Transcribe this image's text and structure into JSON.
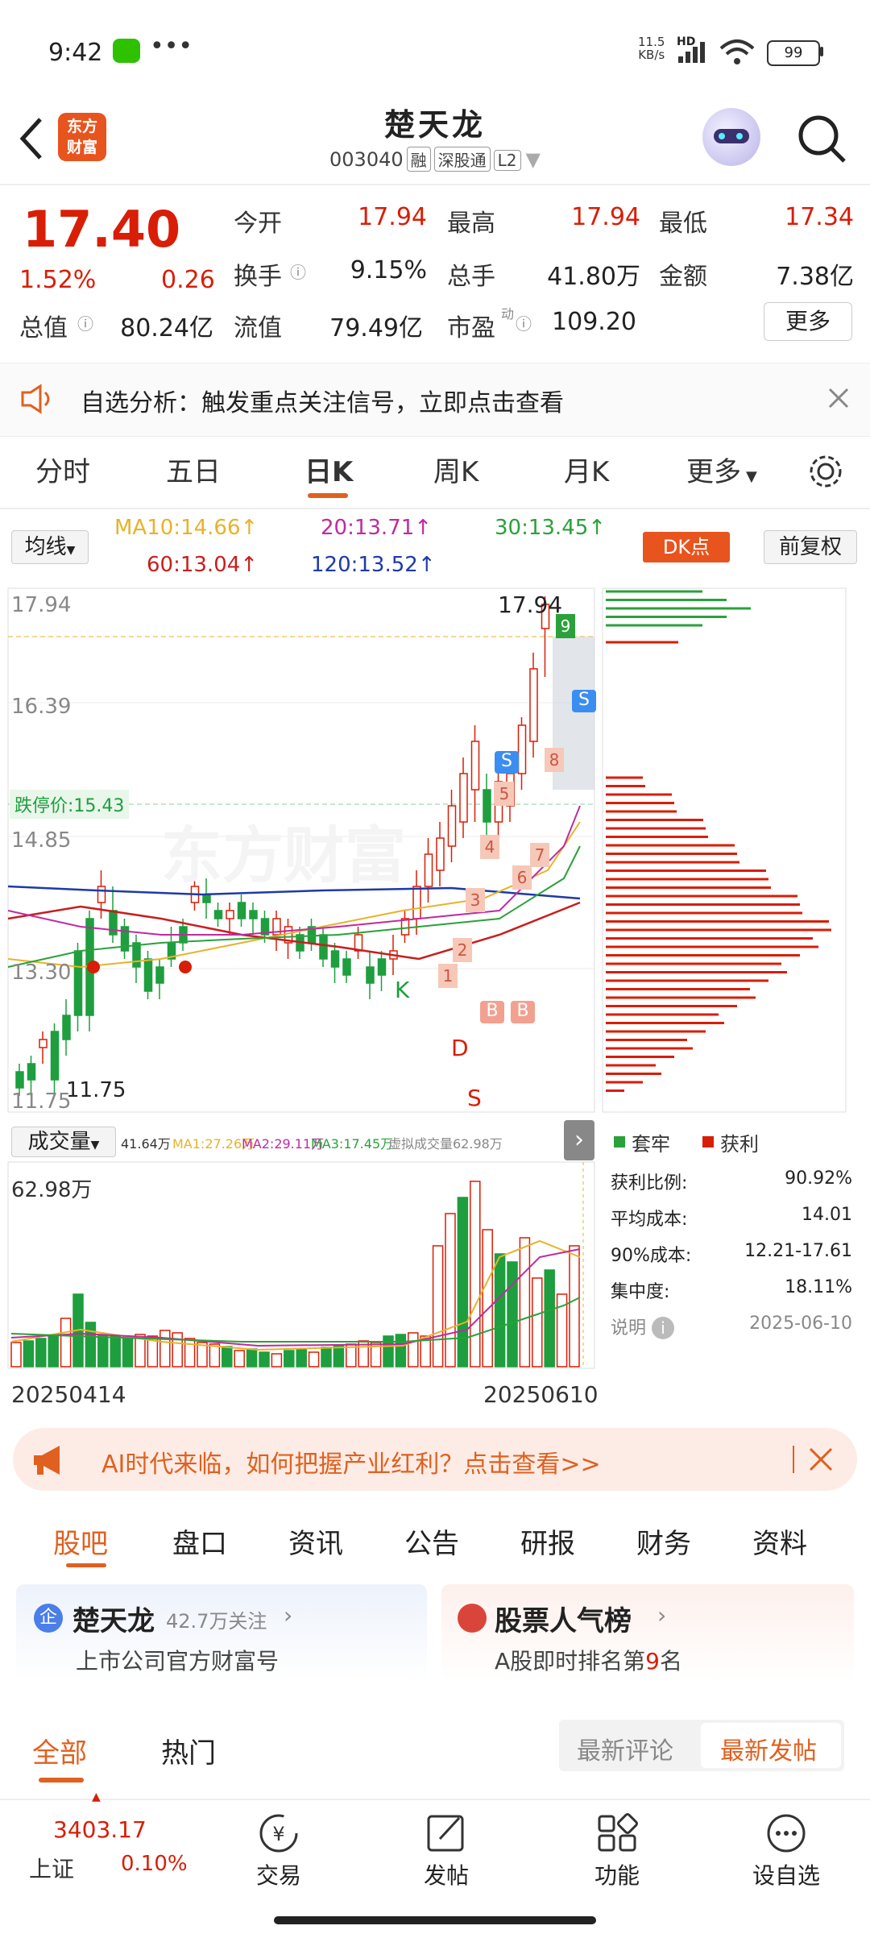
{
  "status_bar": {
    "time": "9:42",
    "net_speed_top": "11.5",
    "net_speed_bottom": "KB/s",
    "hd": "HD",
    "battery": "99"
  },
  "header": {
    "logo_line1": "东方",
    "logo_line2": "财富",
    "stock_name": "楚天龙",
    "stock_code": "003040",
    "tags": [
      "融",
      "深股通",
      "L2"
    ]
  },
  "quote": {
    "price": "17.40",
    "change_pct": "1.52%",
    "change": "0.26",
    "rows": [
      [
        {
          "label": "今开",
          "value": "17.94",
          "color": "red"
        },
        {
          "label": "最高",
          "value": "17.94",
          "color": "red"
        },
        {
          "label": "最低",
          "value": "17.34",
          "color": "red"
        }
      ],
      [
        {
          "label": "换手",
          "value": "9.15%",
          "color": "dark"
        },
        {
          "label": "总手",
          "value": "41.80万",
          "color": "dark"
        },
        {
          "label": "金额",
          "value": "7.38亿",
          "color": "dark"
        }
      ],
      [
        {
          "label": "总值",
          "value": "80.24亿",
          "color": "dark"
        },
        {
          "label": "流值",
          "value": "79.49亿",
          "color": "dark"
        },
        {
          "label": "市盈",
          "value": "109.20",
          "color": "dark"
        }
      ]
    ],
    "pe_sup": "动",
    "more_button": "更多"
  },
  "notice": {
    "text": "自选分析：触发重点关注信号，立即点击查看"
  },
  "chart_tabs": {
    "items": [
      "分时",
      "五日",
      "日K",
      "周K",
      "月K",
      "更多"
    ],
    "active": 2
  },
  "ma_bar": {
    "selector": "均线",
    "items": [
      {
        "text": "MA10:14.66↑",
        "color": "#e8b22a"
      },
      {
        "text": "20:13.71↑",
        "color": "#c02aa0"
      },
      {
        "text": "30:13.45↑",
        "color": "#2aa13a"
      },
      {
        "text": "60:13.04↑",
        "color": "#c81e1e"
      },
      {
        "text": "120:13.52↑",
        "color": "#1e3aa8"
      }
    ],
    "dk_button": "DK点",
    "adjust_button": "前复权"
  },
  "kline": {
    "y_labels": [
      "17.94",
      "16.39",
      "14.85",
      "13.30",
      "11.75"
    ],
    "limit_down_label": "跌停价:15.43",
    "high_marker": "17.94",
    "low_marker": "11.75",
    "signal_labels": {
      "k": "K",
      "d": "D",
      "s": "S",
      "b": "B"
    },
    "numbers": [
      "1",
      "2",
      "3",
      "4",
      "5",
      "6",
      "7",
      "8",
      "9"
    ],
    "watermark": "东方财富"
  },
  "chip_legend": {
    "trapped": "套牢",
    "profit": "获利"
  },
  "chip_stats": [
    {
      "label": "获利比例:",
      "value": "90.92%"
    },
    {
      "label": "平均成本:",
      "value": "14.01"
    },
    {
      "label": "90%成本:",
      "value": "12.21-17.61"
    },
    {
      "label": "集中度:",
      "value": "18.11%"
    }
  ],
  "chip_explain": {
    "label": "说明",
    "date": "2025-06-10"
  },
  "volume_bar": {
    "selector": "成交量",
    "items": [
      {
        "text": "41.64万",
        "color": "#333"
      },
      {
        "text": "MA1:27.26万",
        "color": "#e8b22a"
      },
      {
        "text": "MA2:29.11万",
        "color": "#c02aa0"
      },
      {
        "text": "MA3:17.45万",
        "color": "#2aa13a"
      },
      {
        "text": "虚拟成交量62.98万",
        "color": "#888"
      }
    ],
    "max_label": "62.98万"
  },
  "dates": {
    "start": "20250414",
    "end": "20250610"
  },
  "ad_banner": {
    "text": "AI时代来临，如何把握产业红利？点击查看>>"
  },
  "section_tabs": {
    "items": [
      "股吧",
      "盘口",
      "资讯",
      "公告",
      "研报",
      "财务",
      "资料"
    ],
    "active": 0
  },
  "cards": {
    "left": {
      "badge": "企",
      "title": "楚天龙",
      "followers": "42.7万关注",
      "subtitle": "上市公司官方财富号"
    },
    "right": {
      "title": "股票人气榜",
      "subtitle_prefix": "A股即时排名第",
      "rank": "9",
      "subtitle_suffix": "名"
    }
  },
  "feed_tabs": {
    "items": [
      "全部",
      "热门"
    ],
    "sort": [
      "最新评论",
      "最新发帖"
    ],
    "active_sort": 1
  },
  "bottom_bar": {
    "index_value": "3403.17",
    "index_name": "上证",
    "index_change": "0.10%",
    "items": [
      {
        "label": "交易",
        "icon": "yen-cycle-icon"
      },
      {
        "label": "发帖",
        "icon": "edit-icon"
      },
      {
        "label": "功能",
        "icon": "grid-icon"
      },
      {
        "label": "设自选",
        "icon": "more-icon"
      }
    ]
  },
  "colors": {
    "up": "#d81e06",
    "down": "#1e9e3e",
    "accent": "#e0601f"
  }
}
